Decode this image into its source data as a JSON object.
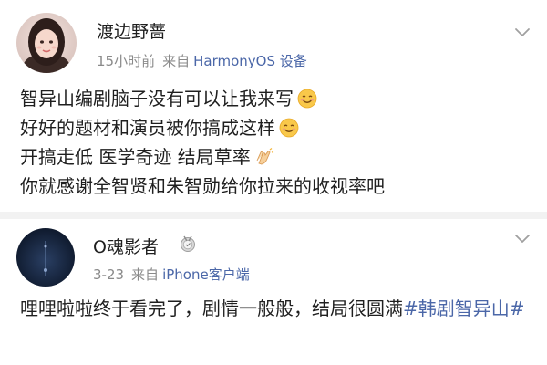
{
  "posts": [
    {
      "user_name": "渡边野蔷",
      "time": "15小时前",
      "source_prefix": "来自",
      "device": "HarmonyOS 设备",
      "lines": [
        "智异山编剧脑子没有可以让我来写",
        "好好的题材和演员被你搞成这样",
        "开搞走低 医学奇迹 结局草率",
        "你就感谢全智贤和朱智勋给你拉来的收视率吧"
      ],
      "icons": {
        "line1": "smile-emoji-icon",
        "line2": "smile-emoji-icon",
        "line3": "clapping-hands-emoji-icon"
      }
    },
    {
      "user_name": "O魂影者",
      "time": "3-23",
      "source_prefix": "来自",
      "device": "iPhone客户端",
      "text": "哩哩啦啦终于看完了，剧情一般般，结局很圆满",
      "hashtag": "#韩剧智异山#",
      "icons": {
        "badge": "medal-badge-icon"
      }
    }
  ],
  "colors": {
    "link_blue": "#4b67a8",
    "meta_gray": "#8a8a8a",
    "divider": "#f2f2f2"
  }
}
